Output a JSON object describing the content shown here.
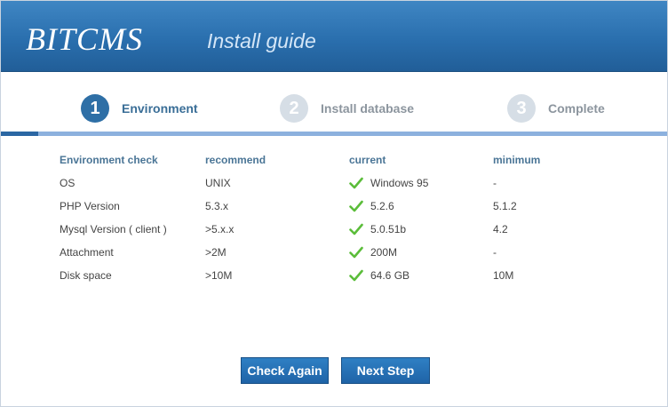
{
  "header": {
    "logo": "BITCMS",
    "subtitle": "Install guide"
  },
  "steps": [
    {
      "number": "1",
      "label": "Environment",
      "active": true
    },
    {
      "number": "2",
      "label": "Install database",
      "active": false
    },
    {
      "number": "3",
      "label": "Complete",
      "active": false
    }
  ],
  "table": {
    "headers": [
      "Environment check",
      "recommend",
      "current",
      "minimum"
    ],
    "rows": [
      {
        "name": "OS",
        "recommend": "UNIX",
        "current": "Windows 95",
        "minimum": "-",
        "status": "ok"
      },
      {
        "name": "PHP Version",
        "recommend": "5.3.x",
        "current": "5.2.6",
        "minimum": "5.1.2",
        "status": "ok"
      },
      {
        "name": "Mysql Version ( client )",
        "recommend": ">5.x.x",
        "current": "5.0.51b",
        "minimum": "4.2",
        "status": "ok"
      },
      {
        "name": "Attachment",
        "recommend": ">2M",
        "current": "200M",
        "minimum": "-",
        "status": "ok"
      },
      {
        "name": "Disk space",
        "recommend": ">10M",
        "current": "64.6 GB",
        "minimum": "10M",
        "status": "ok"
      }
    ]
  },
  "buttons": {
    "check_again": "Check Again",
    "next_step": "Next Step"
  },
  "colors": {
    "header": "#2a6fae",
    "accent": "#2e6fa6",
    "check": "#5bbd3a"
  }
}
